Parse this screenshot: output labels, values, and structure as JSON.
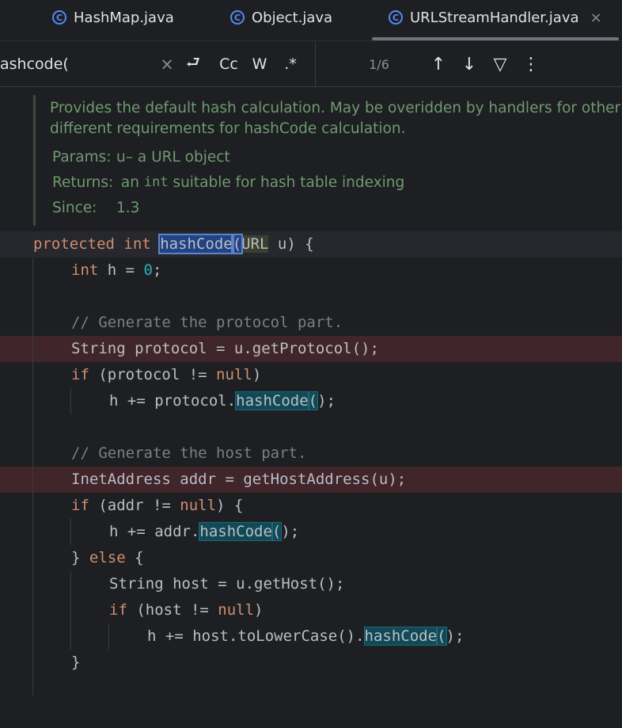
{
  "tabs": [
    {
      "label": "HashMap.java",
      "icon": "class-icon",
      "active": false
    },
    {
      "label": "Object.java",
      "icon": "class-icon",
      "active": false
    },
    {
      "label": "URLStreamHandler.java",
      "icon": "class-icon",
      "active": true
    }
  ],
  "tab_icon_glyph": "C",
  "close_glyph": "×",
  "search": {
    "value": "ashcode(",
    "clear_glyph": "×",
    "newline_glyph": "⮐",
    "match_case_label": "Cc",
    "words_label": "W",
    "regex_label": ".*",
    "match_count": "1/6",
    "prev_glyph": "↑",
    "next_glyph": "↓",
    "filter_glyph": "▽",
    "more_glyph": "⋮"
  },
  "doc": {
    "line1": "Provides the default hash calculation. May be overidden by handlers for other p",
    "line2": "different requirements for hashCode calculation.",
    "params_key": "Params:",
    "params_name": "u",
    "params_value": " – a URL object",
    "returns_key": "Returns:",
    "returns_pre": " an ",
    "returns_code": "int",
    "returns_post": " suitable for hash table indexing",
    "since_key": "Since:",
    "since_value": "1.3"
  },
  "code": {
    "l1_kw1": "protected",
    "l1_kw2": "int",
    "l1_method": "hashCode",
    "l1_paren": "(",
    "l1_type": "URL",
    "l1_rest": " u) {",
    "l2_kw": "int",
    "l2_mid": " h = ",
    "l2_num": "0",
    "l2_end": ";",
    "l4": "// Generate the protocol part.",
    "l5": "String protocol = u.getProtocol();",
    "l6_kw": "if",
    "l6_mid": " (protocol != ",
    "l6_null": "null",
    "l6_end": ")",
    "l7_pre": "h += protocol.",
    "l7_method": "hashCode",
    "l7_paren": "(",
    "l7_end": ");",
    "l9": "// Generate the host part.",
    "l10": "InetAddress addr = getHostAddress(u);",
    "l11_kw": "if",
    "l11_mid": " (addr != ",
    "l11_null": "null",
    "l11_end": ") {",
    "l12_pre": "h += addr.",
    "l12_method": "hashCode",
    "l12_paren": "(",
    "l12_end": ");",
    "l13_pre": "} ",
    "l13_kw": "else",
    "l13_end": " {",
    "l14": "String host = u.getHost();",
    "l15_kw": "if",
    "l15_mid": " (host != ",
    "l15_null": "null",
    "l15_end": ")",
    "l16_pre": "h += host.toLowerCase().",
    "l16_method": "hashCode",
    "l16_paren": "(",
    "l16_end": ");",
    "l17": "}"
  }
}
